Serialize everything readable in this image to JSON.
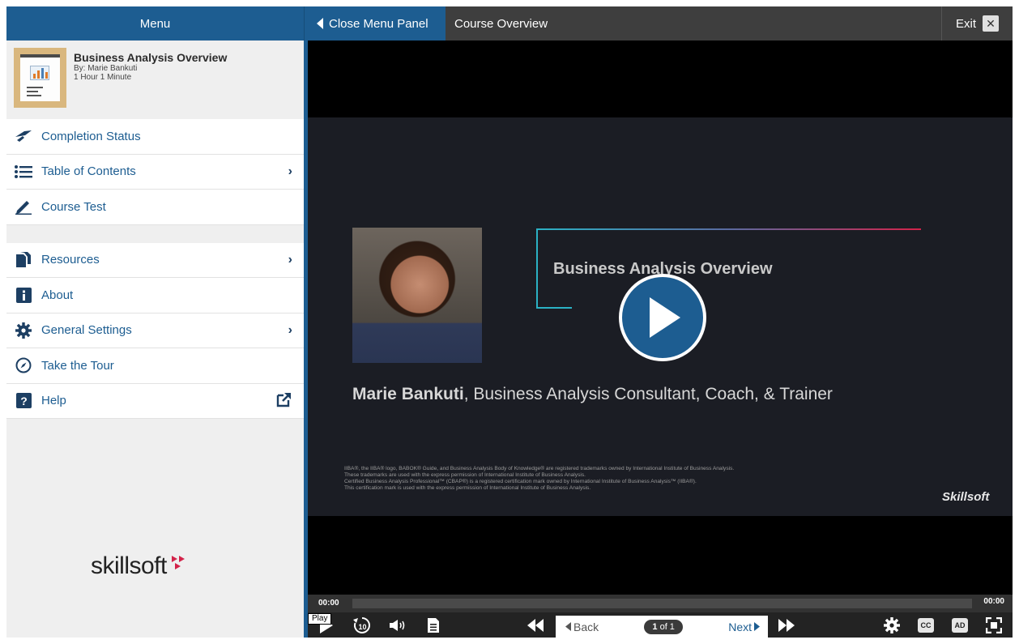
{
  "topbar": {
    "menu_label": "Menu",
    "close_panel_label": "Close Menu Panel",
    "course_title": "Course Overview",
    "exit_label": "Exit"
  },
  "course": {
    "title": "Business Analysis Overview",
    "author": "By: Marie Bankuti",
    "duration": "1 Hour 1 Minute"
  },
  "menu": {
    "items_group1": [
      {
        "label": "Completion Status",
        "icon": "completion-icon"
      },
      {
        "label": "Table of Contents",
        "icon": "list-icon",
        "chevron": true
      },
      {
        "label": "Course Test",
        "icon": "pencil-icon"
      }
    ],
    "items_group2": [
      {
        "label": "Resources",
        "icon": "documents-icon",
        "chevron": true
      },
      {
        "label": "About",
        "icon": "info-icon"
      },
      {
        "label": "General Settings",
        "icon": "gear-icon",
        "chevron": true
      },
      {
        "label": "Take the Tour",
        "icon": "compass-icon"
      },
      {
        "label": "Help",
        "icon": "question-icon",
        "external": true
      }
    ]
  },
  "brand": {
    "logo_text": "skillsoft",
    "accent": "#d3234a",
    "primary": "#1d5d91"
  },
  "slide": {
    "title": "Business Analysis Overview",
    "presenter_name": "Marie Bankuti",
    "presenter_role": ", Business Analysis Consultant, Coach, & Trainer",
    "fine_print": [
      "IIBA®, the IIBA® logo, BABOK® Guide, and Business Analysis Body of Knowledge® are registered trademarks owned by International Institute of Business Analysis.",
      "These trademarks are used with the express permission of International Institute of Business Analysis.",
      "Certified Business Analysis Professional™ (CBAP®) is a registered certification mark owned by International Institute of Business Analysis™ (IIBA®).",
      "This certification mark is used with the express permission of International Institute of Business Analysis."
    ],
    "logo_text": "Skillsoft"
  },
  "player": {
    "time_current": "00:00",
    "time_total": "00:00",
    "play_tooltip": "Play",
    "back_label": "Back",
    "next_label": "Next",
    "page_current": "1",
    "page_of": "of 1",
    "cc_label": "CC",
    "ad_label": "AD",
    "rewind_seconds": "10"
  }
}
